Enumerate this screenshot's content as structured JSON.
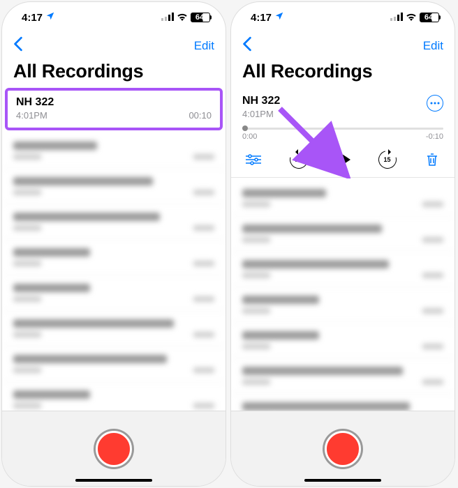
{
  "status": {
    "time": "4:17",
    "battery": "64"
  },
  "nav": {
    "edit": "Edit"
  },
  "title": "All Recordings",
  "recording": {
    "name": "NH 322",
    "time": "4:01PM",
    "duration": "00:10"
  },
  "playback": {
    "elapsed": "0:00",
    "remaining": "-0:10",
    "skip_back": "15",
    "skip_fwd": "15"
  },
  "blur_widths": [
    120,
    160,
    180,
    100,
    100,
    210,
    200,
    100,
    140
  ]
}
